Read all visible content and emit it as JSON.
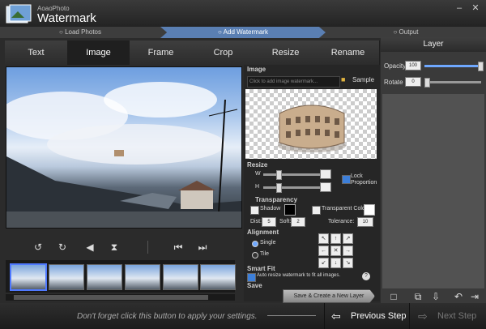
{
  "app": {
    "brand_small": "AoaoPhoto",
    "brand_big": "Watermark"
  },
  "window": {
    "minimize_icon": "minimize-icon",
    "close_icon": "close-icon"
  },
  "steps": [
    "Load Photos",
    "Add Watermark",
    "Output"
  ],
  "tabs": [
    "Text",
    "Image",
    "Frame",
    "Crop",
    "Resize",
    "Rename"
  ],
  "active_tab": "Image",
  "image_section": {
    "title": "Image",
    "input_placeholder": "Click to add image watermark...",
    "sample_label": "Sample"
  },
  "resize_section": {
    "title": "Resize",
    "w_label": "W",
    "h_label": "H",
    "lock_label": "Lock Proportion"
  },
  "transparency_section": {
    "title": "Transparency",
    "shadow_label": "Shadow",
    "transparent_color_label": "Transparent Color",
    "dist_label": "Dist:",
    "dist_value": "5",
    "soft_label": "Soft:",
    "soft_value": "2",
    "tolerance_label": "Tolerance:",
    "tolerance_value": "10"
  },
  "alignment_section": {
    "title": "Alignment",
    "single_label": "Single",
    "tile_label": "Tile",
    "arrows": [
      "↖",
      "↑",
      "↗",
      "←",
      "✕",
      "→",
      "↙",
      "↓",
      "↘"
    ]
  },
  "smartfit_section": {
    "title": "Smart Fit",
    "auto_resize_label": "Auto resize watermark to fit all images.",
    "help_icon": "?"
  },
  "save_section": {
    "title": "Save",
    "button_label": "Save & Create a New Layer"
  },
  "layer_panel": {
    "title": "Layer",
    "opacity_label": "Opacity",
    "opacity_value": "100",
    "rotate_label": "Rotate",
    "rotate_value": "0"
  },
  "bottom": {
    "hint": "Don't forget click this button to apply your settings.",
    "prev_label": "Previous Step",
    "next_label": "Next Step"
  },
  "colors": {
    "accent": "#5a7fb3",
    "thumb_border_selected": "#4f79ff"
  }
}
